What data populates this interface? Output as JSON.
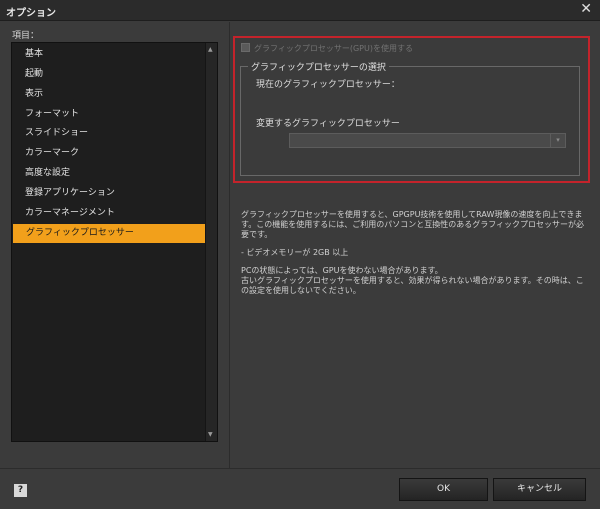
{
  "window": {
    "title": "オプション",
    "close_glyph": "✕"
  },
  "sidebar": {
    "label": "項目：",
    "items": [
      {
        "label": "基本"
      },
      {
        "label": "起動"
      },
      {
        "label": "表示"
      },
      {
        "label": "フォーマット"
      },
      {
        "label": "スライドショー"
      },
      {
        "label": "カラーマーク"
      },
      {
        "label": "高度な設定"
      },
      {
        "label": "登録アプリケーション"
      },
      {
        "label": "カラーマネージメント"
      },
      {
        "label": "グラフィックプロセッサー"
      }
    ],
    "selected_index": 9,
    "selected_color": "#f2a01b",
    "scroll_up_glyph": "▲",
    "scroll_down_glyph": "▼"
  },
  "gpu": {
    "use_gpu_label": "グラフィックプロセッサー(GPU)を使用する",
    "use_gpu_checked": false,
    "use_gpu_disabled": true,
    "group_title": "グラフィックプロセッサーの選択",
    "current_label": "現在のグラフィックプロセッサー：",
    "current_value": "",
    "change_label": "変更するグラフィックプロセッサー",
    "select_value": "",
    "select_arrow_glyph": "▾",
    "highlight_color": "#c4232b"
  },
  "description": {
    "para1": "グラフィックプロセッサーを使用すると、GPGPU技術を使用してRAW現像の速度を向上できます。この機能を使用するには、ご利用のパソコンと互換性のあるグラフィックプロセッサーが必要です。",
    "para2": "- ビデオメモリーが 2GB 以上",
    "para3": "PCの状態によっては、GPUを使わない場合があります。",
    "para4": "古いグラフィックプロセッサーを使用すると、効果が得られない場合があります。その時は、この設定を使用しないでください。"
  },
  "footer": {
    "help_glyph": "?",
    "ok_label": "OK",
    "cancel_label": "キャンセル"
  }
}
